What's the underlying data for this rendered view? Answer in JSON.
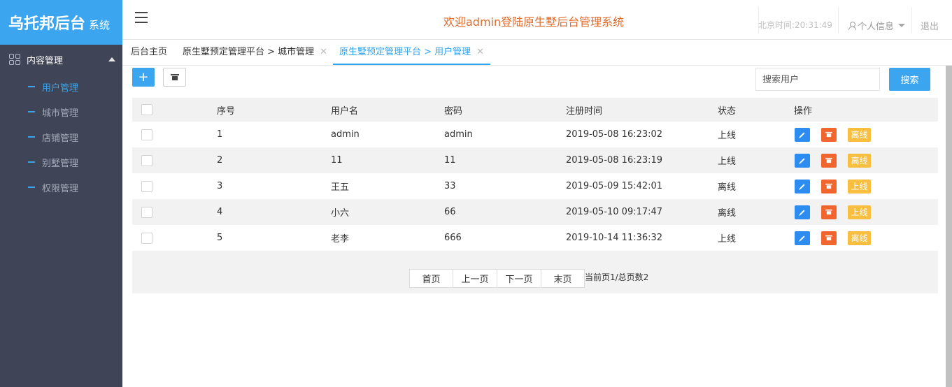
{
  "brand": {
    "name": "乌托邦后台",
    "suffix": "系统"
  },
  "sidebar": {
    "group_label": "内容管理",
    "items": [
      {
        "label": "用户管理",
        "active": true
      },
      {
        "label": "城市管理",
        "active": false
      },
      {
        "label": "店铺管理",
        "active": false
      },
      {
        "label": "别墅管理",
        "active": false
      },
      {
        "label": "权限管理",
        "active": false
      }
    ]
  },
  "header": {
    "welcome": "欢迎admin登陆原生墅后台管理系统",
    "time": "北京时间:20:31:49",
    "user_menu": "个人信息",
    "logout": "退出"
  },
  "tabs": [
    {
      "label": "后台主页",
      "closable": false
    },
    {
      "label": "原生墅预定管理平台 > 城市管理",
      "closable": true
    },
    {
      "label": "原生墅预定管理平台 > 用户管理",
      "closable": true,
      "active": true
    }
  ],
  "toolbar": {
    "add_label": "+",
    "search_placeholder": "搜索用户",
    "search_button": "搜索"
  },
  "table": {
    "columns": [
      "序号",
      "用户名",
      "密码",
      "注册时间",
      "状态",
      "操作"
    ],
    "rows": [
      {
        "id": "1",
        "username": "admin",
        "password": "admin",
        "registered": "2019-05-08 16:23:02",
        "status": "上线",
        "action": "离线"
      },
      {
        "id": "2",
        "username": "11",
        "password": "11",
        "registered": "2019-05-08 16:23:19",
        "status": "上线",
        "action": "离线"
      },
      {
        "id": "3",
        "username": "王五",
        "password": "33",
        "registered": "2019-05-09 15:42:01",
        "status": "离线",
        "action": "上线"
      },
      {
        "id": "4",
        "username": "小六",
        "password": "66",
        "registered": "2019-05-10 09:17:47",
        "status": "离线",
        "action": "上线"
      },
      {
        "id": "5",
        "username": "老李",
        "password": "666",
        "registered": "2019-10-14 11:36:32",
        "status": "上线",
        "action": "离线"
      }
    ]
  },
  "pager": {
    "first": "首页",
    "prev": "上一页",
    "next": "下一页",
    "last": "末页",
    "info": "当前页1/总页数2"
  },
  "colors": {
    "accent": "#3ba5ef",
    "sidebar": "#3f4556",
    "edit": "#2d8cf0",
    "delete": "#f0662e",
    "status": "#f7be3f",
    "welcome": "#e06a2a"
  }
}
